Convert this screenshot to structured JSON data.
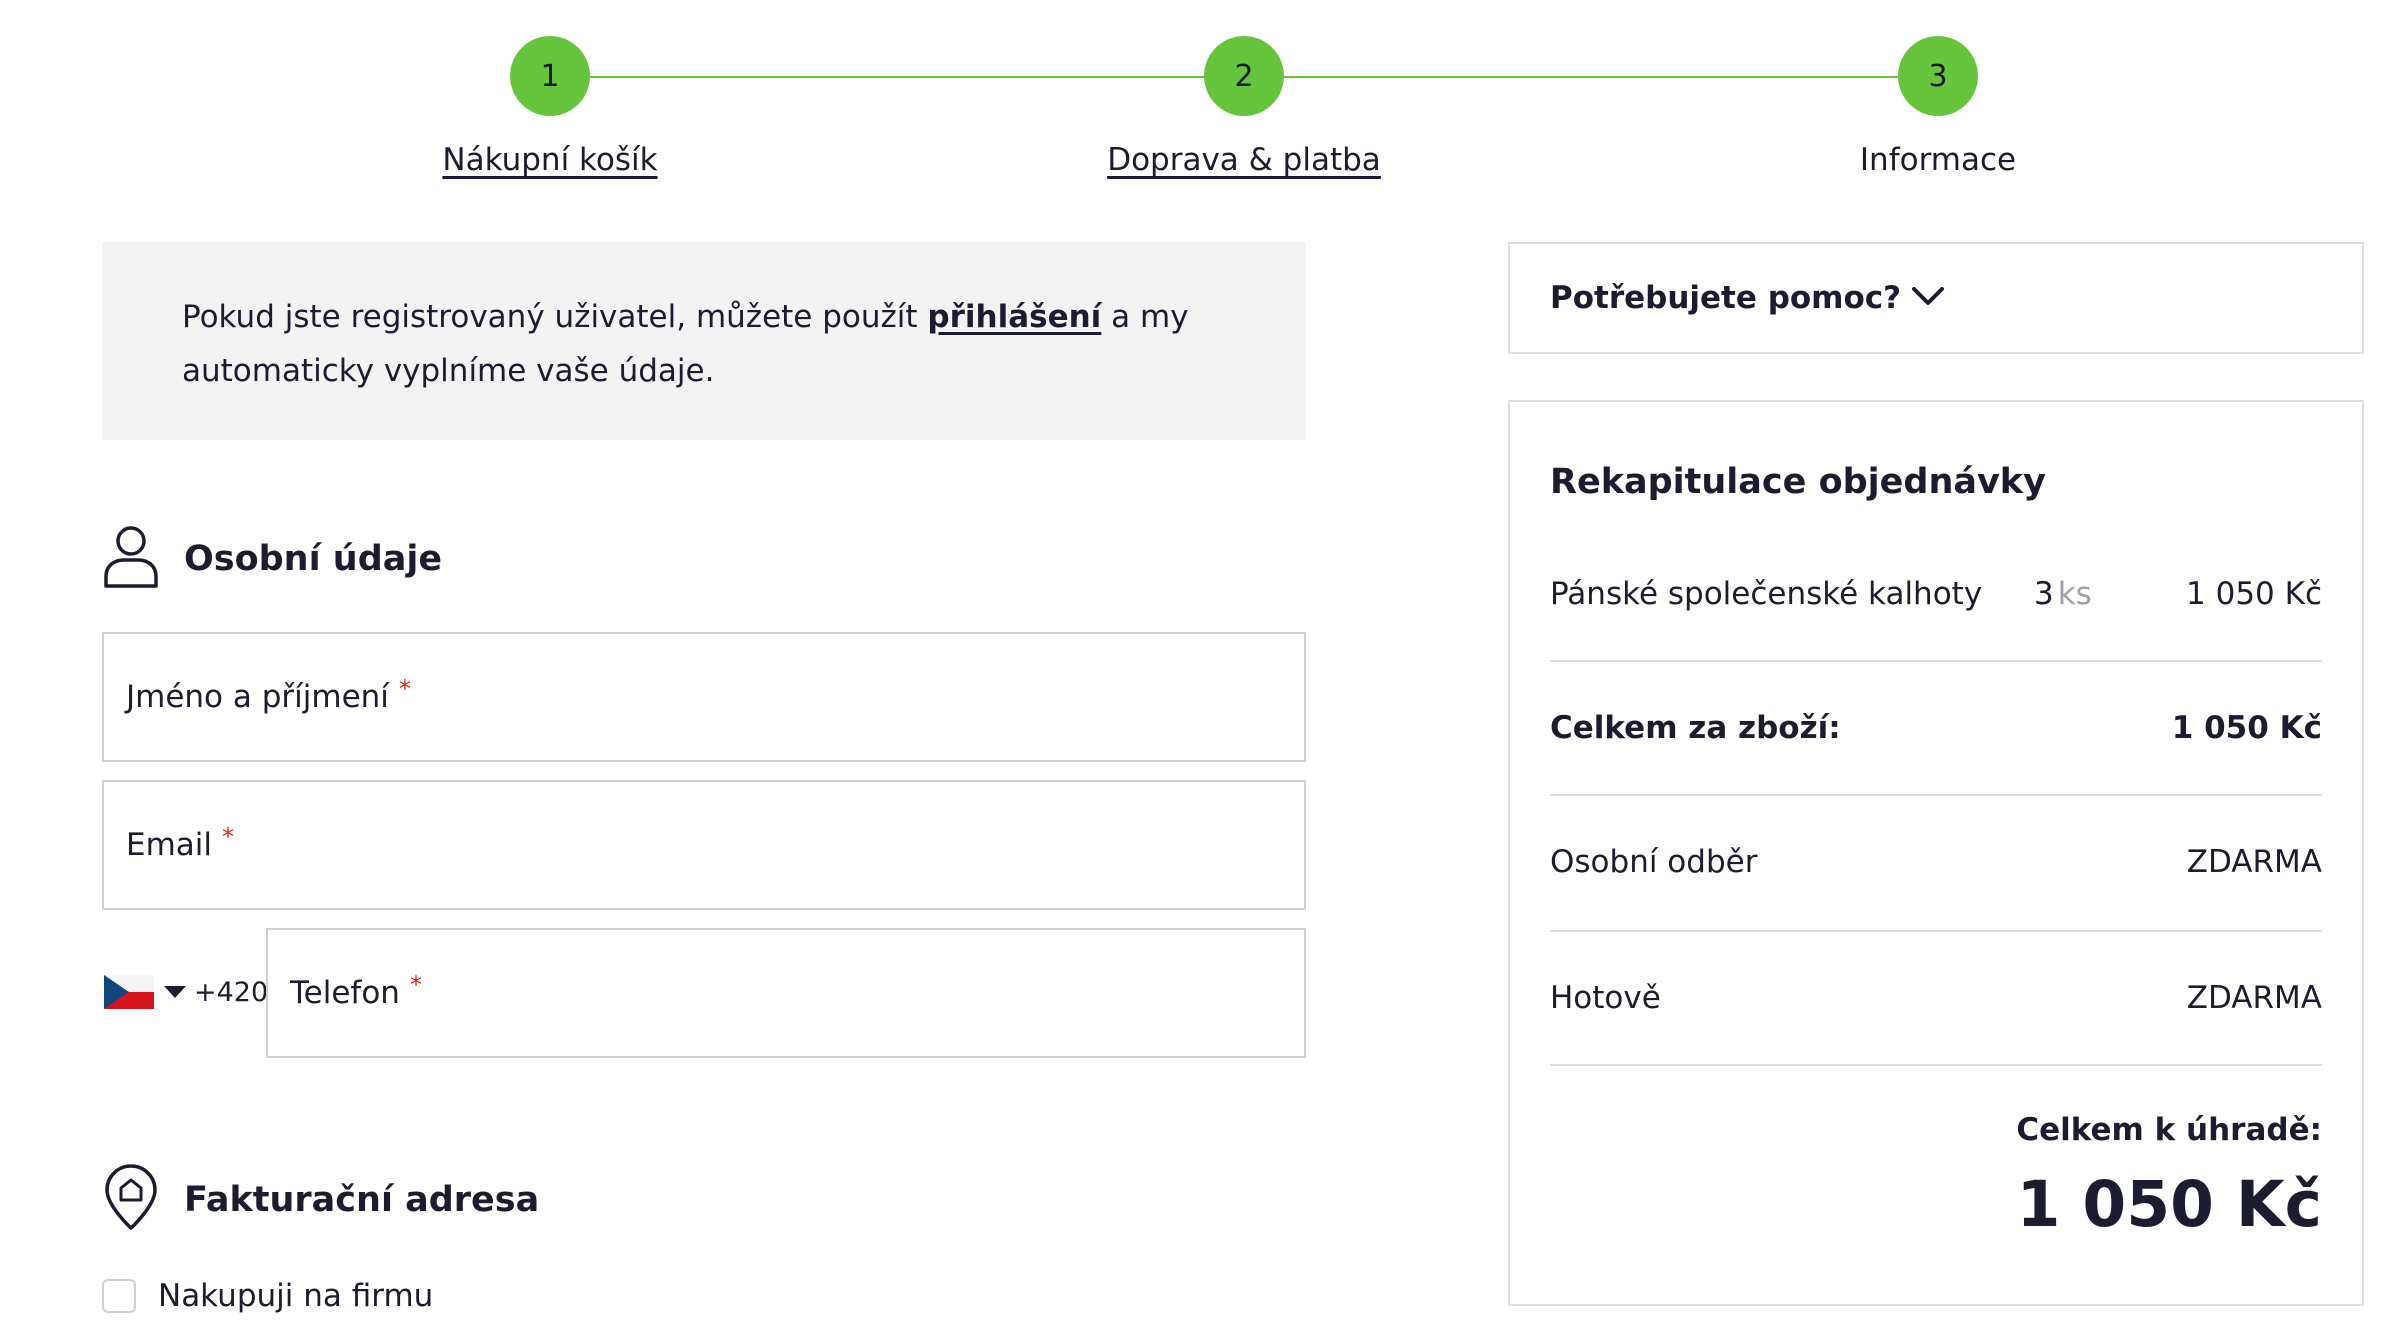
{
  "stepper": {
    "steps": [
      {
        "number": "1",
        "label": "Nákupní košík"
      },
      {
        "number": "2",
        "label": "Doprava & platba"
      },
      {
        "number": "3",
        "label": "Informace"
      }
    ]
  },
  "notice": {
    "text_before": "Pokud jste registrovaný uživatel, můžete použít ",
    "link": "přihlášení",
    "text_after": " a my automaticky vyplníme vaše údaje."
  },
  "personal": {
    "title": "Osobní údaje",
    "name_placeholder": "Jméno a příjmení",
    "email_placeholder": "Email",
    "phone_placeholder": "Telefon",
    "phone_prefix": "+420",
    "required_mark": "*"
  },
  "billing": {
    "title": "Fakturační adresa",
    "company_checkbox": "Nakupuji na firmu"
  },
  "help": {
    "label": "Potřebujete pomoc?"
  },
  "summary": {
    "title": "Rekapitulace objednávky",
    "item": {
      "name": "Pánské společenské kalhoty",
      "qty": "3",
      "unit": "ks",
      "price": "1 050 Kč"
    },
    "goods_total_label": "Celkem za zboží:",
    "goods_total_value": "1 050 Kč",
    "shipping_label": "Osobní odběr",
    "shipping_value": "ZDARMA",
    "payment_label": "Hotově",
    "payment_value": "ZDARMA",
    "pay_total_label": "Celkem k úhradě:",
    "pay_total_value": "1 050 Kč"
  },
  "colors": {
    "accent_green": "#66c53d",
    "text_dark": "#1c1c30",
    "required_red": "#e4271b",
    "notice_bg": "#f3f3f3"
  }
}
